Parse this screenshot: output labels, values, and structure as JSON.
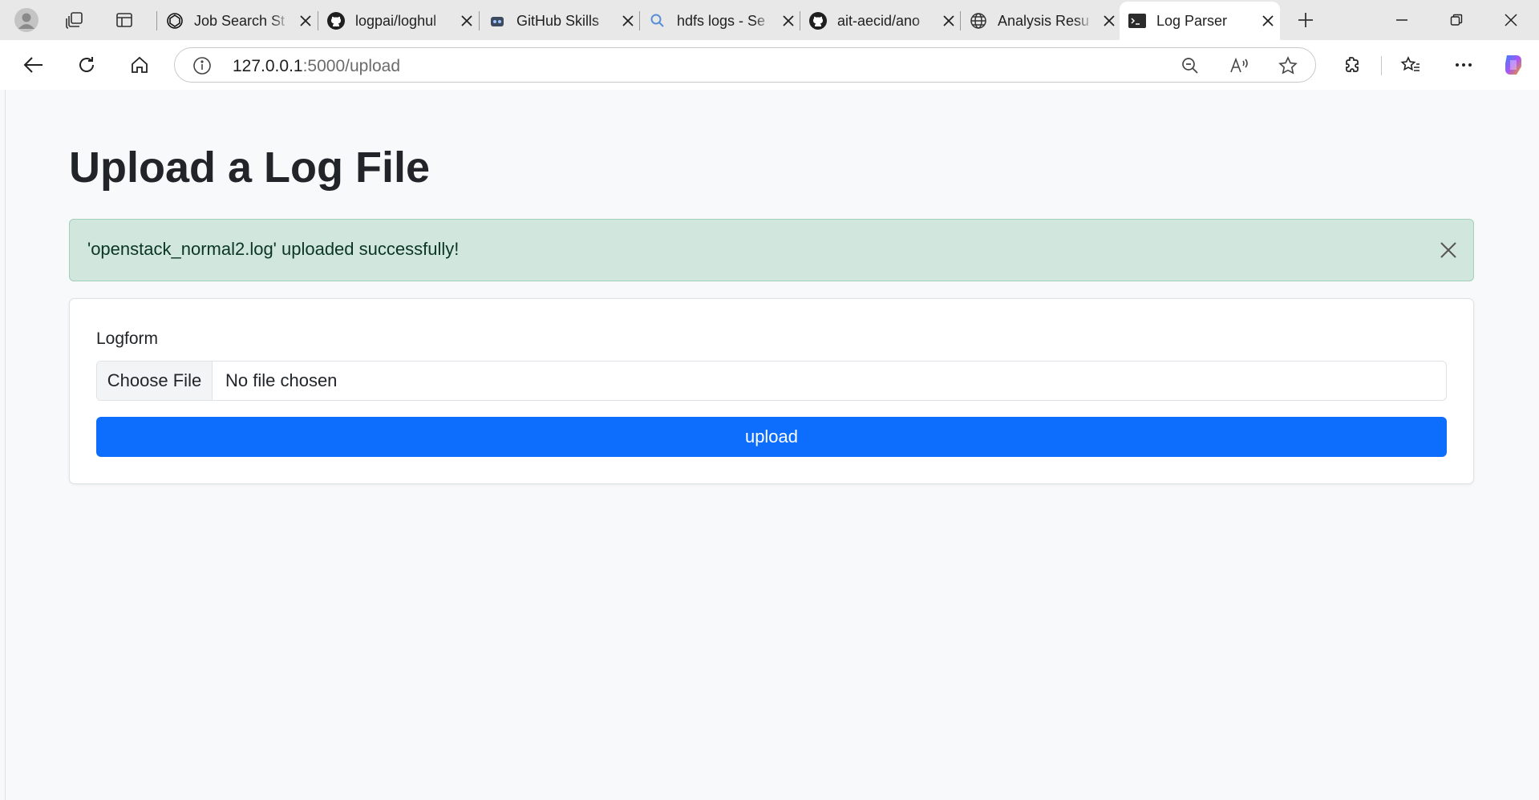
{
  "browser": {
    "tabs": [
      {
        "title": "Job Search St",
        "icon": "openai-icon"
      },
      {
        "title": "logpai/loghul",
        "icon": "github-icon"
      },
      {
        "title": "GitHub Skills",
        "icon": "github-skills-icon"
      },
      {
        "title": "hdfs logs - Se",
        "icon": "search-icon"
      },
      {
        "title": "ait-aecid/ano",
        "icon": "github-icon"
      },
      {
        "title": "Analysis Resu",
        "icon": "globe-icon"
      },
      {
        "title": "Log Parser",
        "icon": "terminal-icon",
        "active": true
      }
    ],
    "address": {
      "host": "127.0.0.1",
      "path": ":5000/upload"
    }
  },
  "page": {
    "heading": "Upload a Log File",
    "alert": {
      "message": "'openstack_normal2.log' uploaded successfully!"
    },
    "form": {
      "label": "Logform",
      "file_button": "Choose File",
      "file_status": "No file chosen",
      "submit": "upload"
    }
  },
  "colors": {
    "primary": "#0d6efd",
    "success_bg": "#d1e7dd",
    "success_text": "#0a3622"
  }
}
